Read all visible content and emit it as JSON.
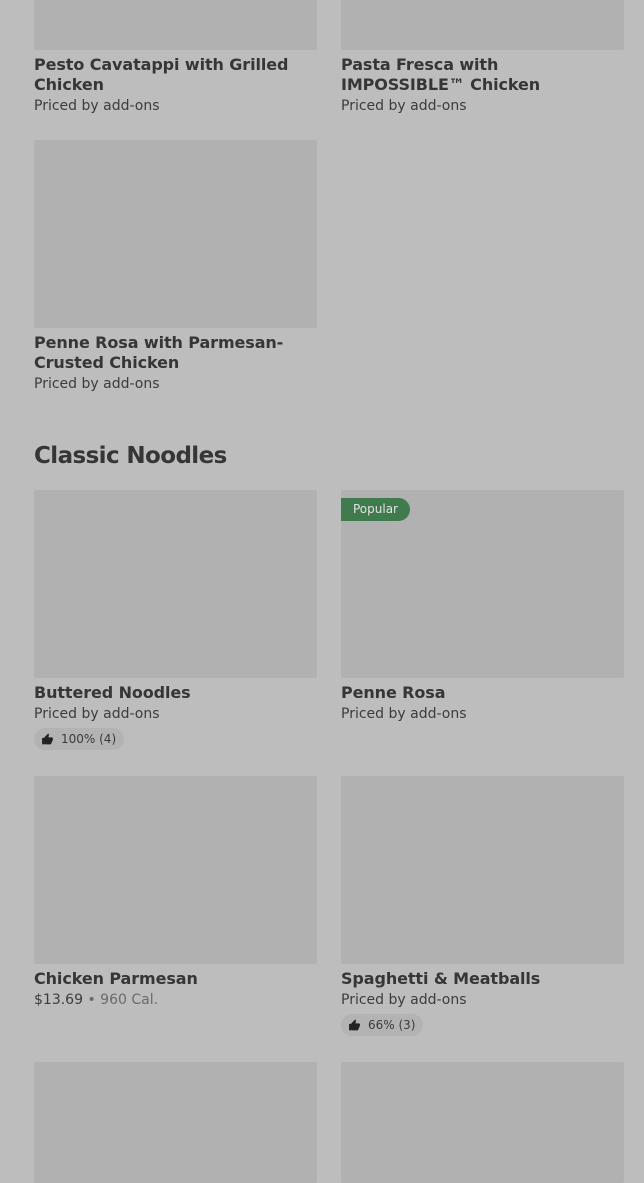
{
  "top_items": [
    {
      "title": "Pesto Cavatappi with Grilled Chicken",
      "price": "Priced by add-ons"
    },
    {
      "title": "Pasta Fresca with IMPOSSIBLE™ Chicken",
      "price": "Priced by add-ons"
    },
    {
      "title": "Penne Rosa with Parmesan-Crusted Chicken",
      "price": "Priced by add-ons"
    }
  ],
  "section": {
    "title": "Classic Noodles",
    "items": [
      {
        "title": "Buttered Noodles",
        "price": "Priced by add-ons",
        "rating": "100% (4)"
      },
      {
        "title": "Penne Rosa",
        "price": "Priced by add-ons",
        "badge": "Popular"
      },
      {
        "title": "Chicken Parmesan",
        "price": "$13.69",
        "separator": "•",
        "calories": "960 Cal."
      },
      {
        "title": "Spaghetti & Meatballs",
        "price": "Priced by add-ons",
        "rating": "66% (3)"
      }
    ]
  },
  "colors": {
    "background": "#bdbdbd",
    "image_placeholder": "#b1b1b1",
    "badge": "#3f7b4c"
  },
  "icons": {
    "rating": "thumbs-up-icon"
  }
}
